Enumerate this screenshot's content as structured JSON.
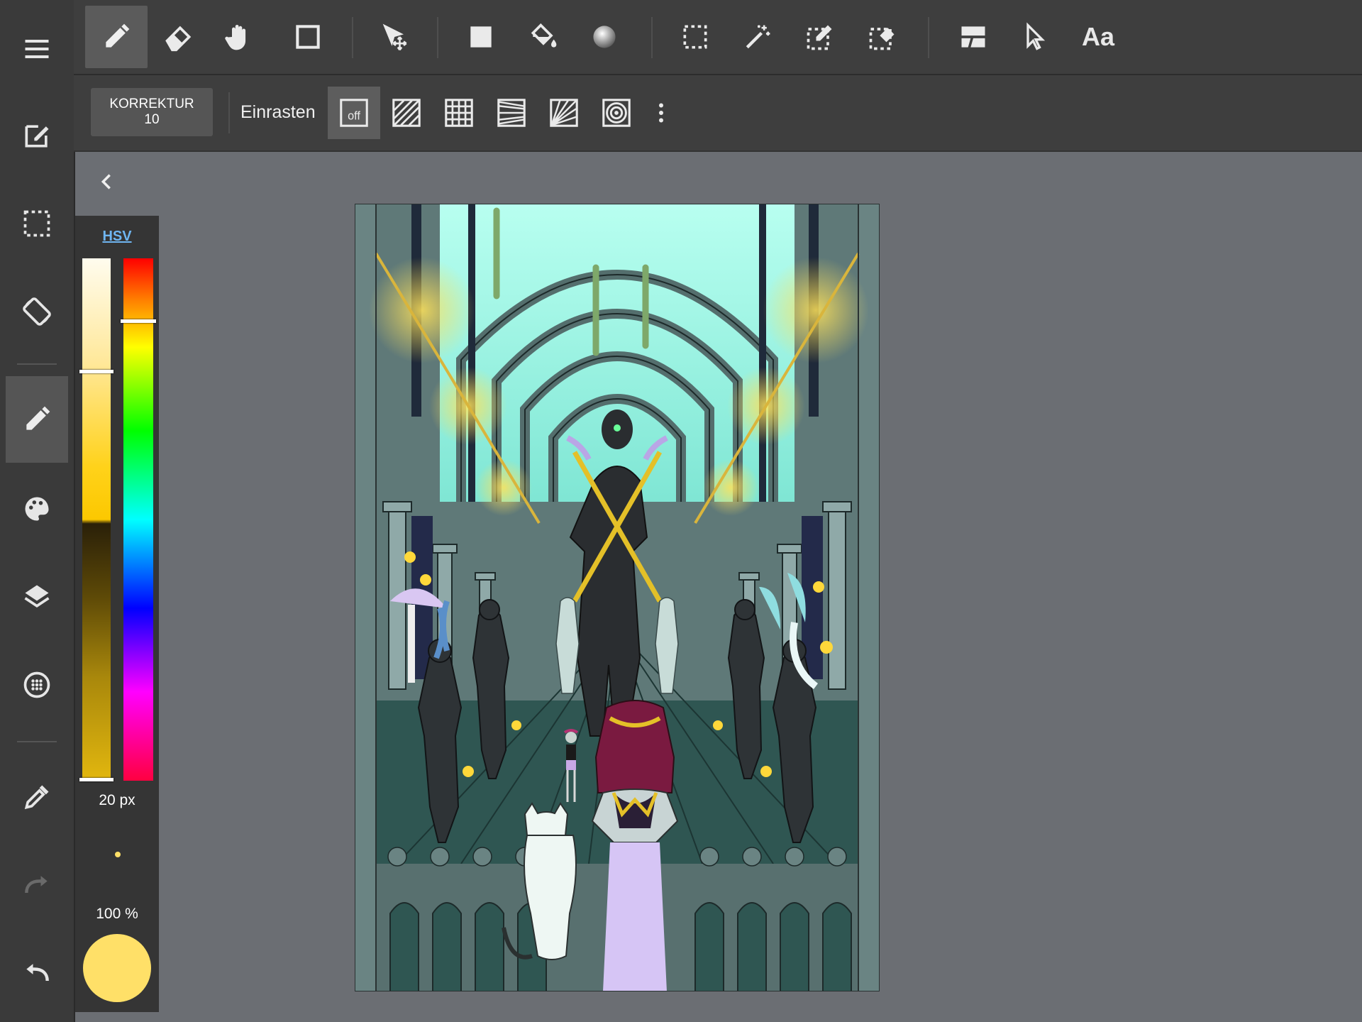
{
  "sidebar": {
    "items": [
      {
        "name": "menu-icon",
        "active": false
      },
      {
        "name": "edit-document-icon",
        "active": false
      },
      {
        "name": "selection-icon",
        "active": false
      },
      {
        "name": "rotate-screen-icon",
        "active": false
      },
      {
        "name": "pen-icon",
        "active": true
      },
      {
        "name": "palette-icon",
        "active": false
      },
      {
        "name": "layers-icon",
        "active": false
      },
      {
        "name": "dots-grid-icon",
        "active": false
      },
      {
        "name": "eyedropper-icon",
        "active": false
      },
      {
        "name": "redo-icon",
        "active": false
      },
      {
        "name": "undo-icon",
        "active": false
      }
    ]
  },
  "toolbar": {
    "tools": [
      "pen-icon",
      "eraser-icon",
      "hand-icon",
      "rectangle-shape-icon",
      "move-icon",
      "fill-rect-icon",
      "bucket-fill-icon",
      "gradient-icon",
      "select-rect-icon",
      "magic-wand-icon",
      "select-pen-icon",
      "select-eraser-icon",
      "frame-icon",
      "pointer-icon",
      "text-icon"
    ],
    "active_tool": "pen-icon",
    "text_tool_label": "Aa"
  },
  "subbar": {
    "correction_label": "KORREKTUR",
    "correction_value": "10",
    "snap_label": "Einrasten",
    "snap_off_label": "off",
    "snap_options": [
      "snap-off-icon",
      "snap-parallel-icon",
      "snap-grid-icon",
      "snap-perspective-icon",
      "snap-radial-icon",
      "snap-circle-icon"
    ],
    "active_snap": "snap-off-icon"
  },
  "color_panel": {
    "mode_label": "HSV",
    "brush_size": "20 px",
    "opacity": "100 %",
    "current_color": "#ffe068",
    "hue_level": 0.12,
    "value_level": 0.58,
    "saturation_level": 1.0
  },
  "colors": {
    "accent_color": "#ffe068",
    "canvas_bg": "#627a79"
  }
}
